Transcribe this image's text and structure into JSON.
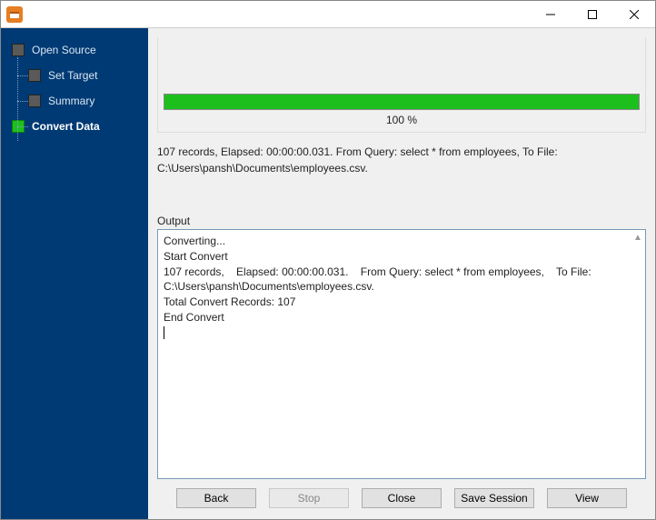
{
  "window": {
    "title": ""
  },
  "sidebar": {
    "items": [
      {
        "label": "Open Source"
      },
      {
        "label": "Set Target"
      },
      {
        "label": "Summary"
      },
      {
        "label": "Convert Data"
      }
    ]
  },
  "progress": {
    "percent_label": "100 %",
    "percent_value": 100
  },
  "status": {
    "line": "107 records,    Elapsed: 00:00:00.031.    From Query: select * from employees,    To File: C:\\Users\\pansh\\Documents\\employees.csv."
  },
  "output": {
    "label": "Output",
    "text": "Converting...\nStart Convert\n107 records,    Elapsed: 00:00:00.031.    From Query: select * from employees,    To File: C:\\Users\\pansh\\Documents\\employees.csv.\nTotal Convert Records: 107\nEnd Convert"
  },
  "buttons": {
    "back": "Back",
    "stop": "Stop",
    "close": "Close",
    "save_session": "Save Session",
    "view": "View"
  }
}
